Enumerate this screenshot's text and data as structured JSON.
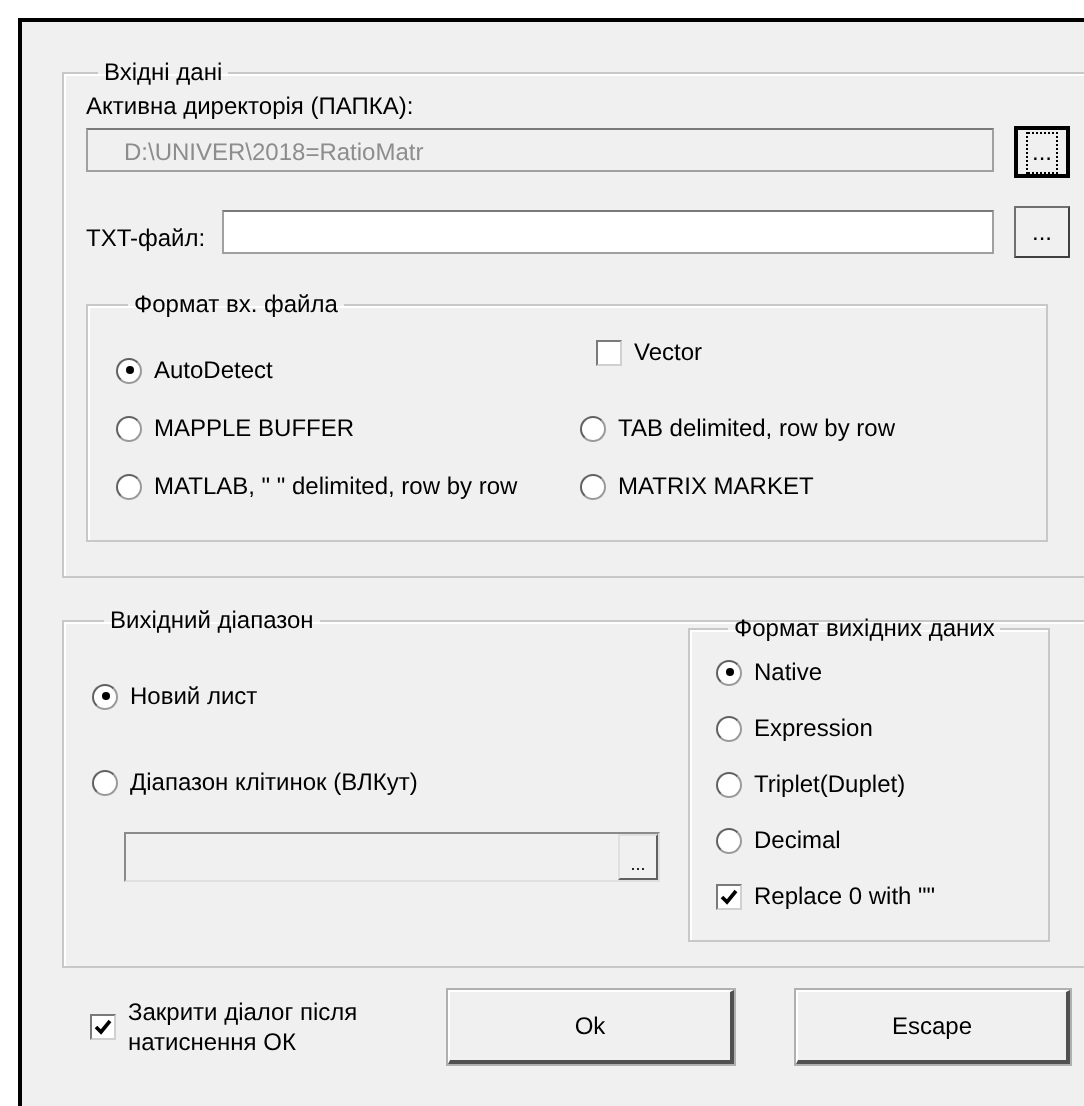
{
  "input_group": {
    "title": "Вхідні дані",
    "directory": {
      "label": "Активна директорія (ПАПКА):",
      "value": "D:\\UNIVER\\2018=RatioMatr",
      "disabled": true,
      "browse": "...",
      "browse_focused": true
    },
    "txt_file": {
      "label": "TXT-файл:",
      "browse": "..."
    },
    "format": {
      "title": "Формат вх. файла",
      "options": [
        {
          "label": "AutoDetect",
          "selected": true
        },
        {
          "label": "MAPPLE BUFFER",
          "selected": false
        },
        {
          "label": "TAB delimited, row by row",
          "selected": false
        },
        {
          "label": "MATLAB, \" \" delimited, row by row",
          "selected": false
        },
        {
          "label": "MATRIX MARKET",
          "selected": false
        }
      ],
      "vector": {
        "label": "Vector",
        "checked": false
      }
    }
  },
  "output_group": {
    "title": "Вихідний діапазон",
    "options": [
      {
        "label": "Новий лист",
        "selected": true
      },
      {
        "label": "Діапазон клітинок (ВЛКут)",
        "selected": false
      }
    ],
    "range_field": {
      "disabled": true,
      "browse": "..."
    },
    "output_format": {
      "title": "Формат вихідних даних",
      "options": [
        {
          "label": "Native",
          "selected": true
        },
        {
          "label": "Expression",
          "selected": false
        },
        {
          "label": "Triplet(Duplet)",
          "selected": false
        },
        {
          "label": "Decimal",
          "selected": false
        }
      ],
      "replace_zero": {
        "label": "Replace 0 with \"\"",
        "checked": true
      }
    }
  },
  "close_after_ok": {
    "label": "Закрити діалог після натиснення ОК",
    "checked": true
  },
  "buttons": [
    "Ok",
    "Escape"
  ]
}
